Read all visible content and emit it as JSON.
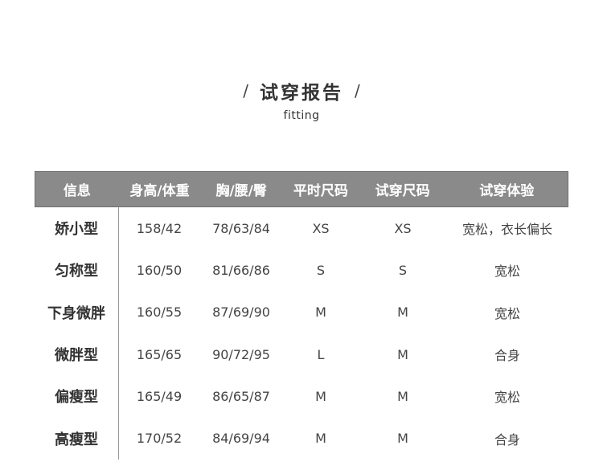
{
  "title": {
    "slash_left": "/",
    "main": "试穿报告",
    "slash_right": "/",
    "subtitle": "fitting"
  },
  "table": {
    "headers": [
      "信息",
      "身高/体重",
      "胸/腰/臀",
      "平时尺码",
      "试穿尺码",
      "试穿体验"
    ],
    "rows": [
      [
        "娇小型",
        "158/42",
        "78/63/84",
        "XS",
        "XS",
        "宽松，衣长偏长"
      ],
      [
        "匀称型",
        "160/50",
        "81/66/86",
        "S",
        "S",
        "宽松"
      ],
      [
        "下身微胖",
        "160/55",
        "87/69/90",
        "M",
        "M",
        "宽松"
      ],
      [
        "微胖型",
        "165/65",
        "90/72/95",
        "L",
        "M",
        "合身"
      ],
      [
        "偏瘦型",
        "165/49",
        "86/65/87",
        "M",
        "M",
        "宽松"
      ],
      [
        "高瘦型",
        "170/52",
        "84/69/94",
        "M",
        "M",
        "合身"
      ]
    ]
  },
  "colors": {
    "header_bg": "#8a8a8a",
    "header_text": "#ffffff",
    "text": "#333333"
  }
}
